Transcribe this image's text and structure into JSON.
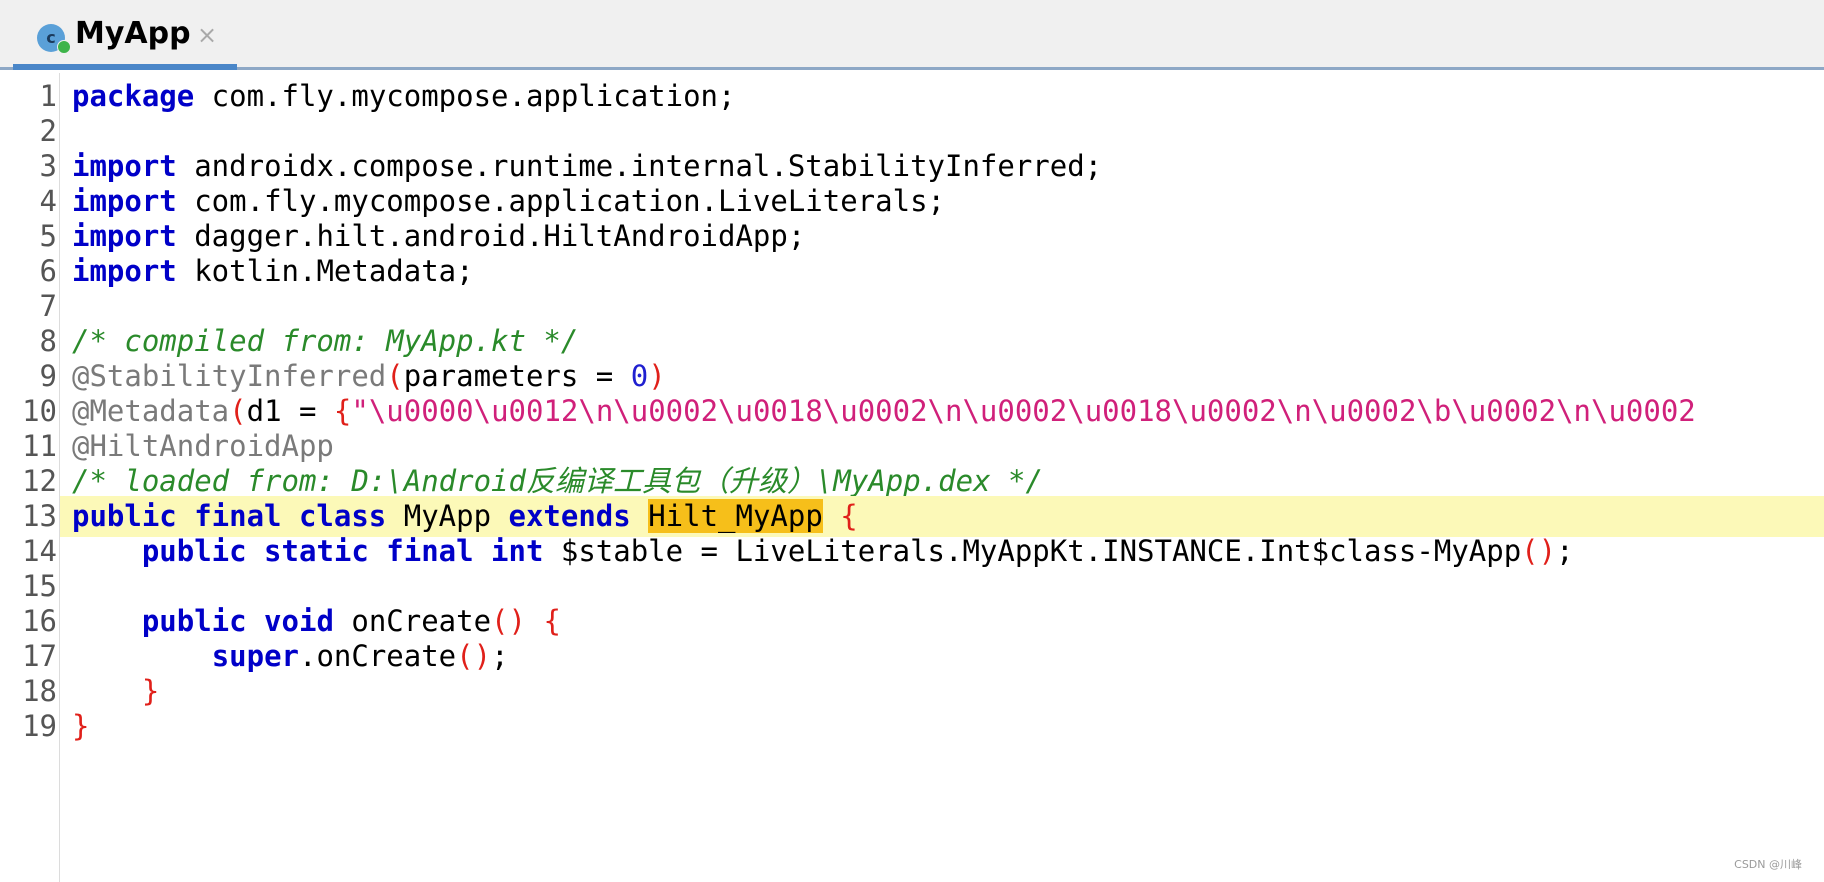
{
  "tab": {
    "title": "MyApp",
    "icon": "kotlin-class-icon",
    "icon_letter": "c",
    "close_glyph": "×"
  },
  "line_numbers": [
    "1",
    "2",
    "3",
    "4",
    "5",
    "6",
    "7",
    "8",
    "9",
    "10",
    "11",
    "12",
    "13",
    "14",
    "15",
    "16",
    "17",
    "18",
    "19"
  ],
  "code": {
    "l1": {
      "kw": "package",
      "rest": " com.fly.mycompose.application;"
    },
    "l3": {
      "kw": "import",
      "rest": " androidx.compose.runtime.internal.StabilityInferred;"
    },
    "l4": {
      "kw": "import",
      "rest": " com.fly.mycompose.application.LiveLiterals;"
    },
    "l5": {
      "kw": "import",
      "rest": " dagger.hilt.android.HiltAndroidApp;"
    },
    "l6": {
      "kw": "import",
      "rest": " kotlin.Metadata;"
    },
    "l8": {
      "comment": "/* compiled from: MyApp.kt */"
    },
    "l9": {
      "ann": "@StabilityInferred",
      "open": "(",
      "param": "parameters = ",
      "num": "0",
      "close": ")"
    },
    "l10": {
      "ann": "@Metadata",
      "open": "(",
      "param": "d1 = ",
      "brace": "{",
      "str": "\"\\u0000\\u0012\\n\\u0002\\u0018\\u0002\\n\\u0002\\u0018\\u0002\\n\\u0002\\b\\u0002\\n\\u0002"
    },
    "l11": {
      "ann": "@HiltAndroidApp"
    },
    "l12": {
      "comment": "/* loaded from: D:\\Android反编译工具包（升级）\\MyApp.dex */"
    },
    "l13": {
      "kw1": "public final class",
      "name": " MyApp ",
      "kw2": "extends",
      "sp": " ",
      "super": "Hilt_MyApp",
      "sp2": " ",
      "brace": "{"
    },
    "l14": {
      "indent": "    ",
      "kw1": "public static final int",
      "rest": " $stable = LiveLiterals.MyAppKt.INSTANCE.Int$class-MyApp",
      "paren": "()",
      "end": ";"
    },
    "l16": {
      "indent": "    ",
      "kw1": "public void",
      "rest": " onCreate",
      "paren": "()",
      "sp": " ",
      "brace": "{"
    },
    "l17": {
      "indent": "        ",
      "kw": "super",
      "rest": ".onCreate",
      "paren": "()",
      "end": ";"
    },
    "l18": {
      "indent": "    ",
      "brace": "}"
    },
    "l19": {
      "brace": "}"
    }
  },
  "watermark": "CSDN @川峰"
}
